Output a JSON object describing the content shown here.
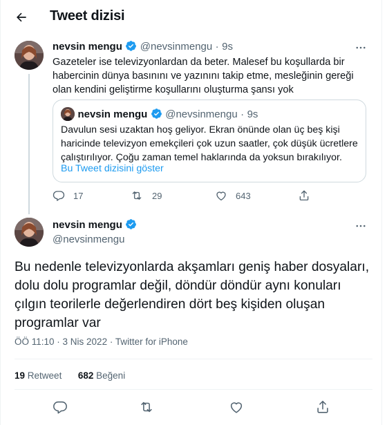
{
  "header": {
    "title": "Tweet dizisi"
  },
  "colors": {
    "accent": "#1d9bf0",
    "text": "#0f1419",
    "muted": "#536471",
    "border": "#cfd9de"
  },
  "tweet1": {
    "name": "nevsin mengu",
    "handle": "@nevsinmengu",
    "sep": "·",
    "time": "9s",
    "text": "Gazeteler ise televizyonlardan da beter. Malesef bu koşullarda bir habercinin dünya basınını ve yazınını takip etme, mesleğinin gereği olan kendini geliştirme koşullarını oluşturma şansı yok",
    "quote": {
      "name": "nevsin mengu",
      "handle": "@nevsinmengu",
      "sep": "·",
      "time": "9s",
      "text": "Davulun sesi uzaktan hoş geliyor. Ekran önünde olan üç beş kişi haricinde televizyon emekçileri çok uzun saatler, çok düşük ücretlere çalıştırılıyor. Çoğu zaman temel haklarında da yoksun bırakılıyor.",
      "link": "Bu Tweet dizisini göster"
    },
    "replies": "17",
    "retweets": "29",
    "likes": "643"
  },
  "tweet2": {
    "name": "nevsin mengu",
    "handle": "@nevsinmengu",
    "text": "Bu nedenle televizyonlarda akşamları geniş haber dosyaları, dolu dolu programlar değil, döndür döndür aynı konuları çılgın teorilerle değerlendiren dört beş kişiden oluşan programlar var",
    "meta": "ÖÖ 11:10 · 3 Nis 2022 · Twitter for iPhone",
    "retweet_count": "19",
    "retweet_label": "Retweet",
    "like_count": "682",
    "like_label": "Beğeni"
  },
  "icons": [
    "back-arrow-icon",
    "verified-badge-icon",
    "more-icon",
    "reply-icon",
    "retweet-icon",
    "like-icon",
    "share-icon"
  ]
}
